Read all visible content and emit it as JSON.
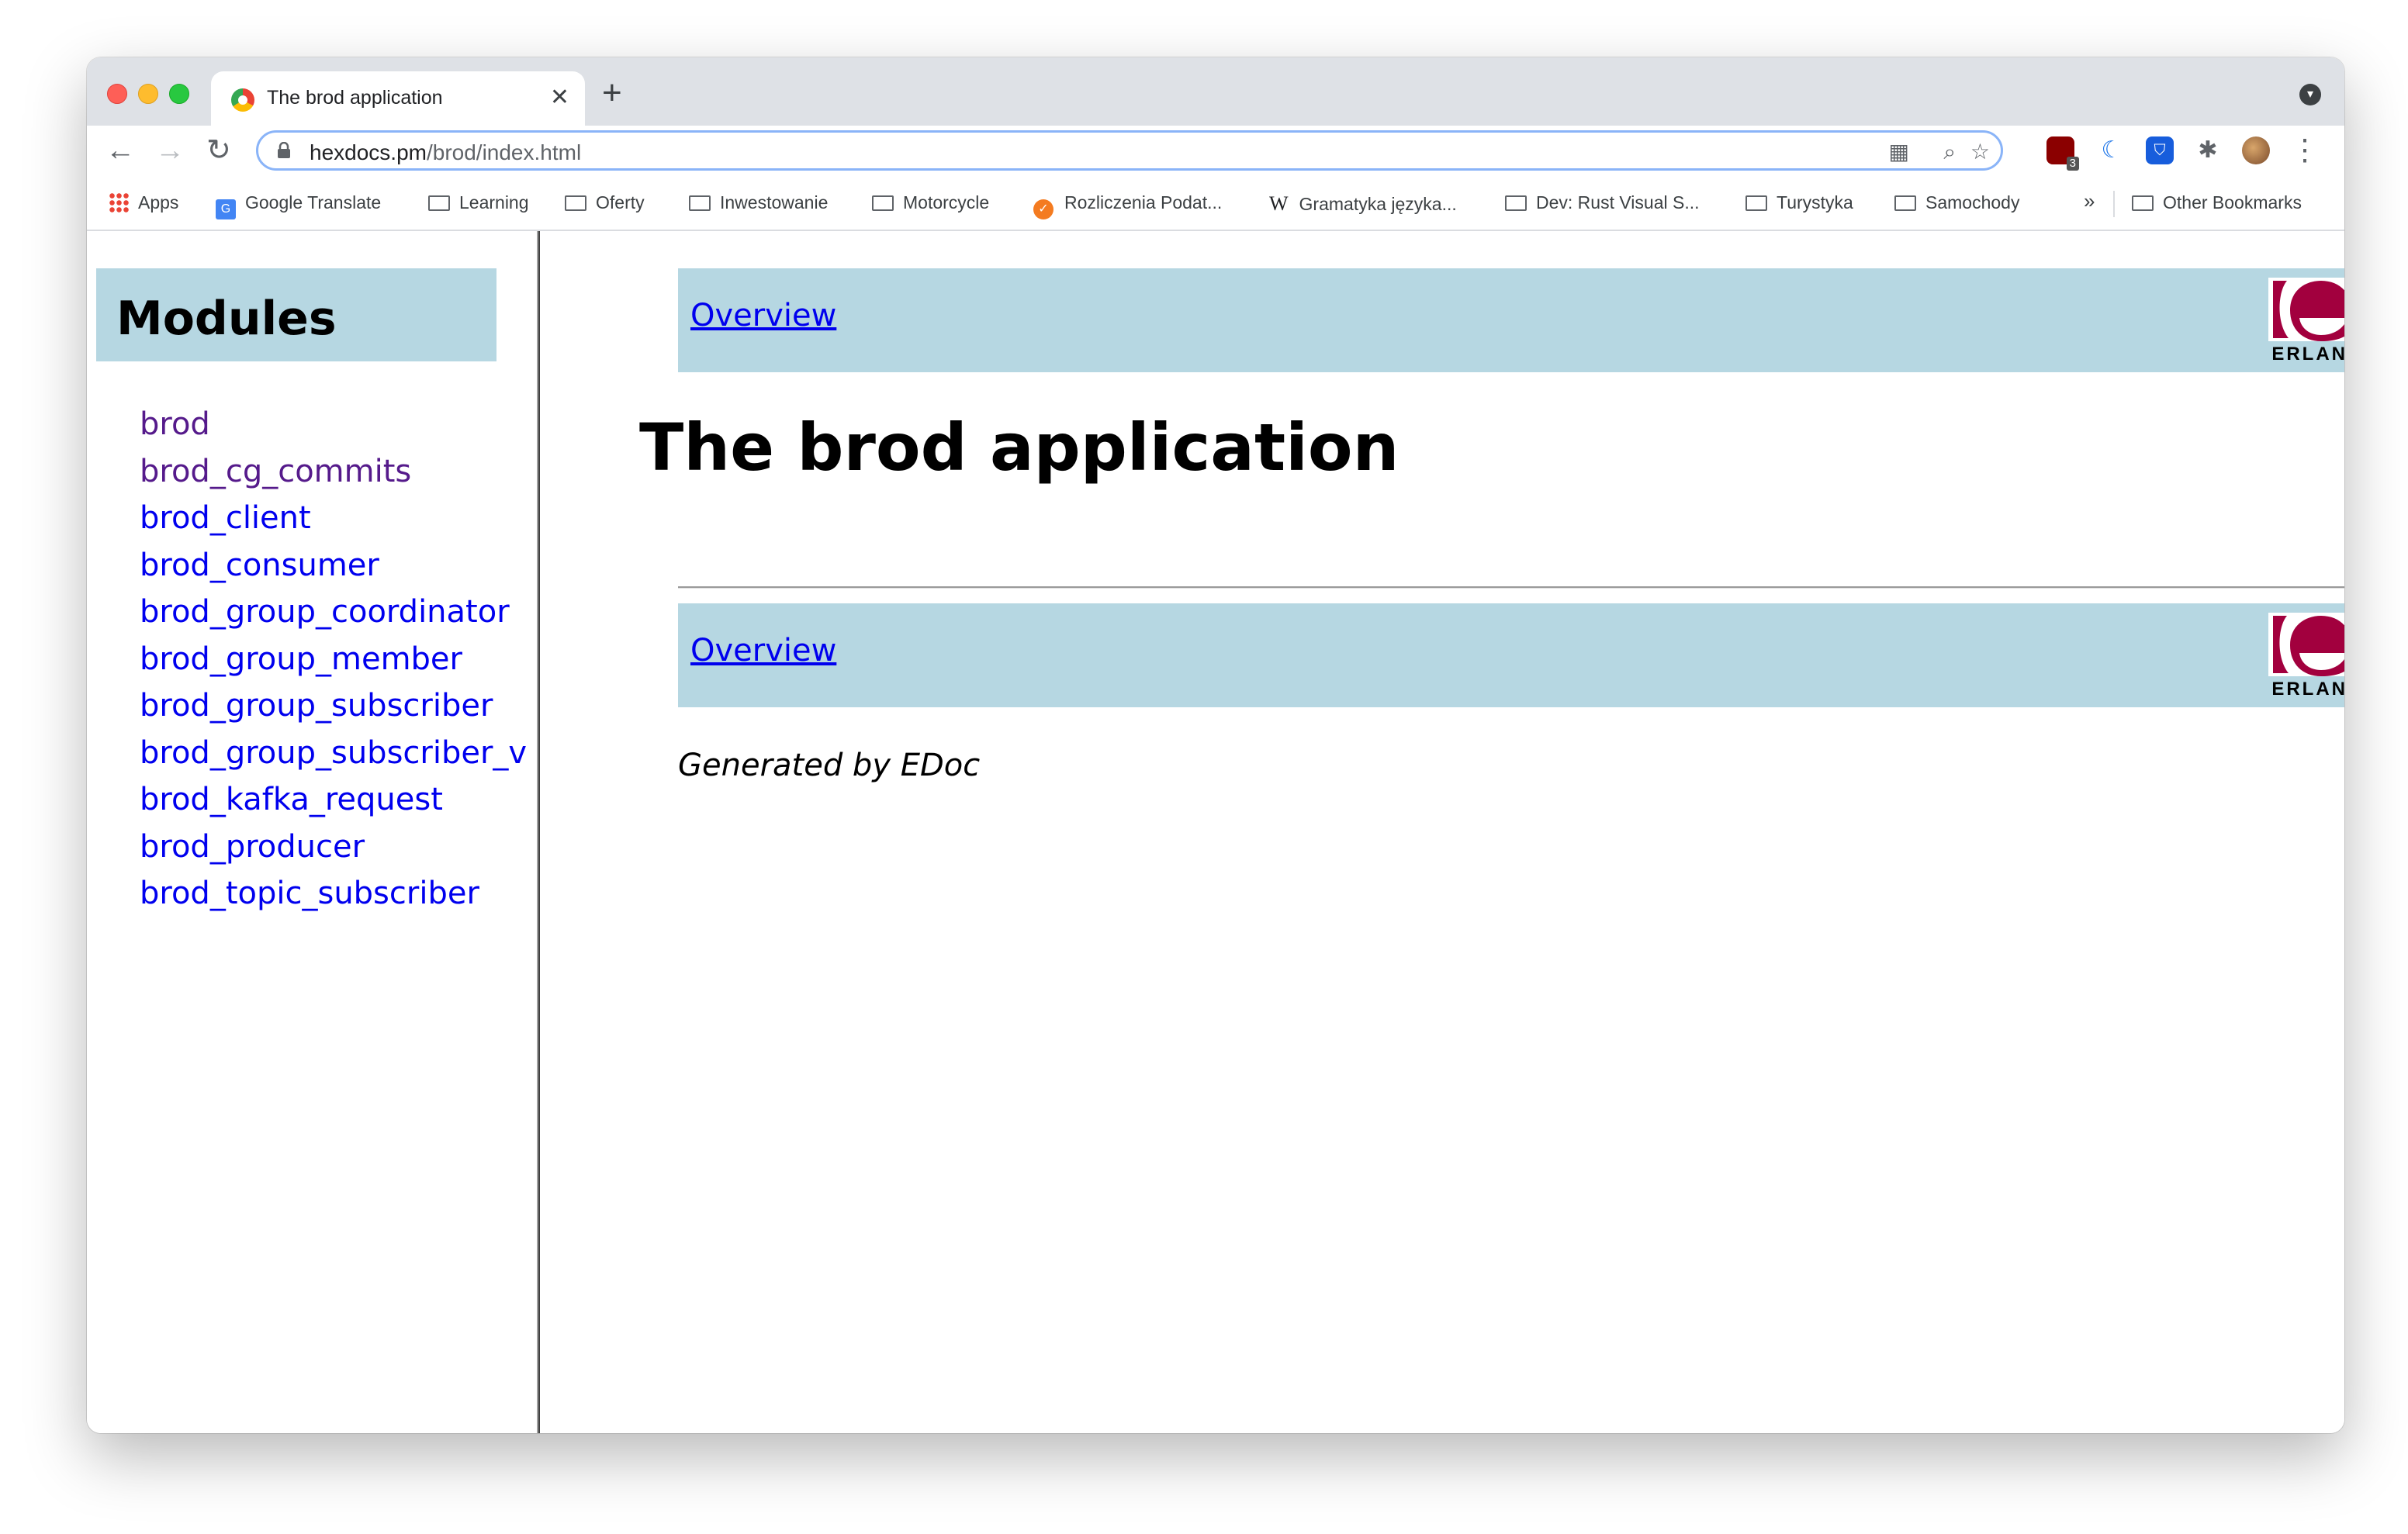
{
  "browser": {
    "tab_title": "The brod application",
    "tab_close": "✕",
    "new_tab": "+",
    "url_host": "hexdocs.pm",
    "url_path": "/brod/index.html",
    "nav": {
      "back": "←",
      "forward": "→",
      "reload": "↻"
    },
    "omnibox_icons": {
      "qr": "▦",
      "zoom": "⌕",
      "star": "☆"
    },
    "extensions": {
      "badge_count": "3",
      "menu": "⋮"
    }
  },
  "bookmarks": {
    "items": [
      {
        "label": "Apps",
        "icon": "apps-grid-icon"
      },
      {
        "label": "Google Translate",
        "icon": "google-translate-icon"
      },
      {
        "label": "Learning",
        "icon": "folder-icon"
      },
      {
        "label": "Oferty",
        "icon": "folder-icon"
      },
      {
        "label": "Inwestowanie",
        "icon": "folder-icon"
      },
      {
        "label": "Motorcycle",
        "icon": "folder-icon"
      },
      {
        "label": "Rozliczenia Podat...",
        "icon": "site-icon"
      },
      {
        "label": "Gramatyka języka...",
        "icon": "wikipedia-icon"
      },
      {
        "label": "Dev: Rust Visual S...",
        "icon": "folder-icon"
      },
      {
        "label": "Turystyka",
        "icon": "folder-icon"
      },
      {
        "label": "Samochody",
        "icon": "folder-icon"
      }
    ],
    "overflow": "»",
    "other": "Other Bookmarks"
  },
  "sidebar": {
    "heading": "Modules",
    "modules": [
      {
        "name": "brod",
        "visited": true
      },
      {
        "name": "brod_cg_commits",
        "visited": true
      },
      {
        "name": "brod_client",
        "visited": false
      },
      {
        "name": "brod_consumer",
        "visited": false
      },
      {
        "name": "brod_group_coordinator",
        "visited": false
      },
      {
        "name": "brod_group_member",
        "visited": false
      },
      {
        "name": "brod_group_subscriber",
        "visited": false
      },
      {
        "name": "brod_group_subscriber_v",
        "visited": false
      },
      {
        "name": "brod_kafka_request",
        "visited": false
      },
      {
        "name": "brod_producer",
        "visited": false
      },
      {
        "name": "brod_topic_subscriber",
        "visited": false
      }
    ]
  },
  "main": {
    "navbar_link": "Overview",
    "logo_text": "ERLANG",
    "title": "The brod application",
    "footer": "Generated by EDoc"
  },
  "colors": {
    "navbar_bg": "#b6d7e2",
    "link": "#0000ee",
    "visited_link": "#551a8b",
    "erlang_red": "#a2003e"
  }
}
